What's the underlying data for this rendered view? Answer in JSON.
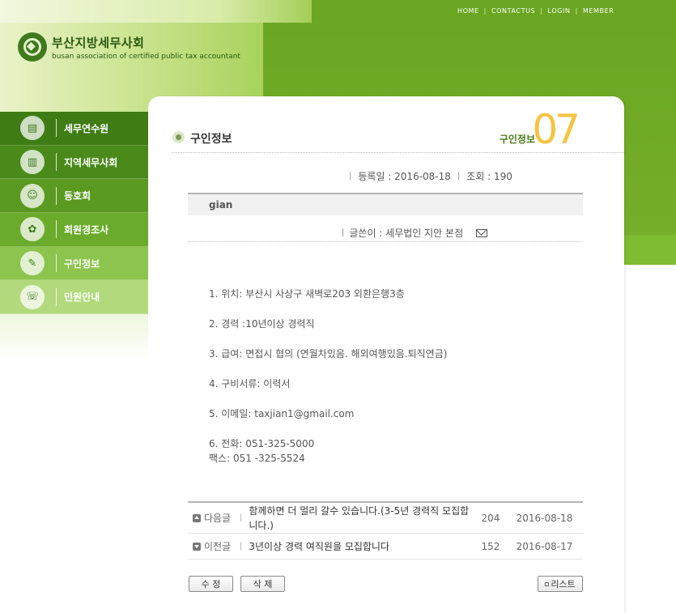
{
  "topnav": {
    "home": "HOME",
    "contact": "CONTACTUS",
    "login": "LOGIN",
    "member": "MEMBER",
    "sep": "|"
  },
  "logo": {
    "name_ko": "부산지방세무사회",
    "name_en": "busan association of certified public tax accountant"
  },
  "sidebar": {
    "items": [
      {
        "label": "세무연수원",
        "bg": "#3f7c14"
      },
      {
        "label": "지역세무사회",
        "bg": "#4a8a1a"
      },
      {
        "label": "동호회",
        "bg": "#5b9a20"
      },
      {
        "label": "회원경조사",
        "bg": "#6bab2b"
      },
      {
        "label": "구인정보",
        "bg": "#8cc44d"
      },
      {
        "label": "민원안내",
        "bg": "#b2da7c"
      }
    ]
  },
  "section": {
    "title": "구인정보",
    "sub_title": "구인정보",
    "number": "07"
  },
  "post": {
    "reg_label": "등록일 : 2016-08-18",
    "views_label": "조회 : 190",
    "title": "gian",
    "writer": "글쓴이 : 세무법인 지안 본점",
    "body": [
      "1. 위치: 부산시 사상구 새벽로203 외환은행3층",
      "2. 경력 :10년이상 경력직",
      "3. 급여: 면접시 협의 (연월차있음. 해외여행있음.퇴직연금)",
      "4. 구비서류: 이력서",
      "5. 이메일: taxjian1@gmail.com",
      "6. 전화: 051-325-5000",
      "팩스: 051 -325-5524"
    ]
  },
  "nav": {
    "next": {
      "label": "다음글",
      "title": "함께하면 더 멀리 갈수 있습니다.(3-5년 경력직 모집합니다.)",
      "hits": "204",
      "date": "2016-08-18"
    },
    "prev": {
      "label": "이전글",
      "title": "3년이상 경력 여직원을 모집합니다",
      "hits": "152",
      "date": "2016-08-17"
    }
  },
  "buttons": {
    "edit": "수 정",
    "delete": "삭 제",
    "list": "리스트"
  },
  "colors": {
    "accent_green": "#6aa622",
    "number_yellow": "#f5c33f"
  }
}
